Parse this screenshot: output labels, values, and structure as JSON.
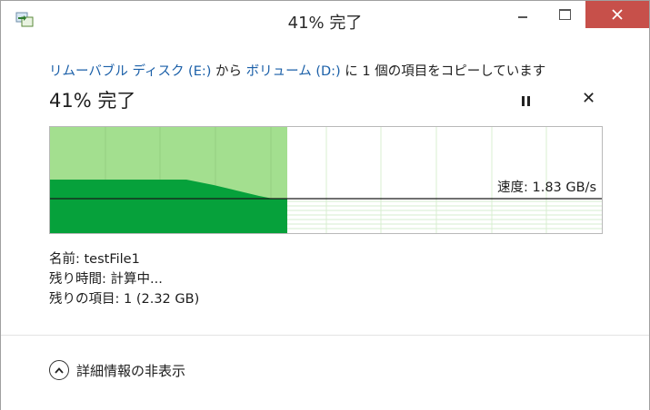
{
  "window": {
    "title": "41% 完了"
  },
  "status": {
    "copy_prefix": "リムーバブル ディスク (E:)",
    "copy_mid": " から ",
    "copy_dest": "ボリューム (D:)",
    "copy_suffix": " に 1 個の項目をコピーしています",
    "percent_label": "41% 完了",
    "progress": 0.41,
    "speed_label": "速度: 1.83 GB/s"
  },
  "details": {
    "name_line": "名前: testFile1",
    "time_left_line": "残り時間: 計算中...",
    "items_left_line": "残りの項目: 1 (2.32 GB)"
  },
  "footer": {
    "toggle_label": "詳細情報の非表示"
  },
  "colors": {
    "progress_light": "#a3df8f",
    "progress_dark": "#06a13b",
    "close_button": "#c7504a",
    "link": "#1a5fa8"
  },
  "icons": {
    "app": "copy-files-icon",
    "pause": "pause-icon",
    "cancel": "close-icon",
    "toggle": "chevron-up-icon"
  }
}
